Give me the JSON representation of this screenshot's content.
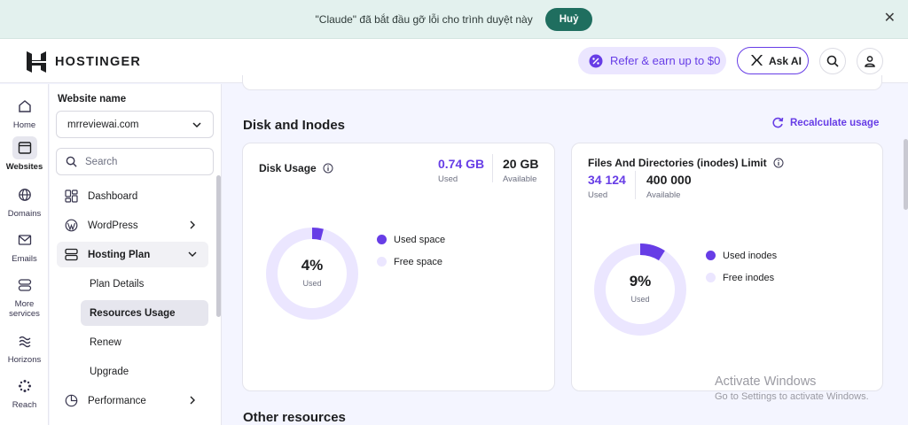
{
  "banner": {
    "message": "\"Claude\" đã bắt đầu gỡ lỗi cho trình duyệt này",
    "cancel_label": "Huỷ"
  },
  "header": {
    "brand": "HOSTINGER",
    "refer_label": "Refer & earn up to $0",
    "ask_ai_label": "Ask AI"
  },
  "rail": {
    "items": [
      {
        "label": "Home",
        "icon": "home-icon"
      },
      {
        "label": "Websites",
        "icon": "websites-icon"
      },
      {
        "label": "Domains",
        "icon": "globe-icon"
      },
      {
        "label": "Emails",
        "icon": "mail-icon"
      },
      {
        "label": "More",
        "label2": "services",
        "icon": "services-icon"
      },
      {
        "label": "Horizons",
        "icon": "horizons-icon"
      },
      {
        "label": "Reach",
        "icon": "reach-icon"
      }
    ]
  },
  "sidebar": {
    "website_label": "Website name",
    "website_value": "mrreviewai.com",
    "search_placeholder": "Search",
    "items": [
      {
        "label": "Dashboard",
        "icon": "dashboard-icon"
      },
      {
        "label": "WordPress",
        "icon": "wordpress-icon"
      },
      {
        "label": "Hosting Plan",
        "icon": "server-icon"
      },
      {
        "label": "Performance",
        "icon": "performance-icon"
      }
    ],
    "sub_items": [
      {
        "label": "Plan Details"
      },
      {
        "label": "Resources Usage"
      },
      {
        "label": "Renew"
      },
      {
        "label": "Upgrade"
      }
    ]
  },
  "main": {
    "section_title": "Disk and Inodes",
    "recalculate_label": "Recalculate usage",
    "disk": {
      "title": "Disk Usage",
      "used_value": "0.74 GB",
      "used_label": "Used",
      "available_value": "20 GB",
      "available_label": "Available",
      "percent_label": "4%",
      "percent": 0.04,
      "center_sub": "Used",
      "legend_used": "Used space",
      "legend_free": "Free space"
    },
    "inodes": {
      "title": "Files And Directories (inodes) Limit",
      "used_value": "34 124",
      "used_label": "Used",
      "available_value": "400 000",
      "available_label": "Available",
      "percent_label": "9%",
      "percent": 0.09,
      "center_sub": "Used",
      "legend_used": "Used inodes",
      "legend_free": "Free inodes"
    },
    "other_title": "Other resources"
  },
  "watermark": {
    "line1": "Activate Windows",
    "line2": "Go to Settings to activate Windows."
  },
  "colors": {
    "accent": "#673de6",
    "donut_track": "#ebe6ff",
    "banner_button": "#1f6e5f"
  }
}
